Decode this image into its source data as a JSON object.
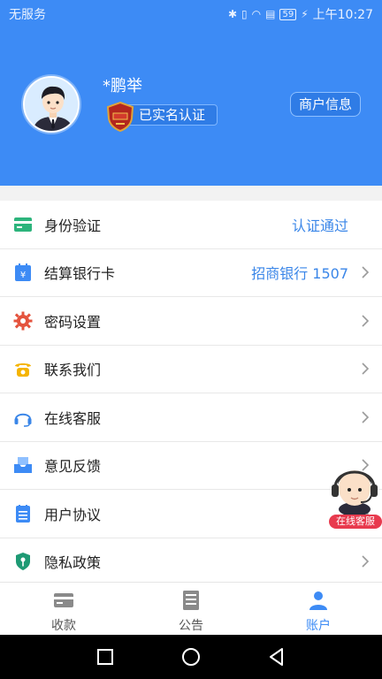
{
  "status_bar": {
    "carrier": "无服务",
    "battery": "59",
    "time": "上午10:27"
  },
  "profile": {
    "name": "*鹏举",
    "verified_label": "已实名认证",
    "merchant_button": "商户信息"
  },
  "menu": [
    {
      "label": "身份验证",
      "value": "认证通过",
      "icon": "id-card-icon",
      "color": "#2db47c",
      "arrow": false
    },
    {
      "label": "结算银行卡",
      "value": "招商银行 1507",
      "icon": "calendar-bank-icon",
      "color": "#3d8bf5",
      "arrow": true
    },
    {
      "label": "密码设置",
      "value": "",
      "icon": "gear-icon",
      "color": "#e4533d",
      "arrow": true
    },
    {
      "label": "联系我们",
      "value": "",
      "icon": "phone-icon",
      "color": "#f5b400",
      "arrow": true
    },
    {
      "label": "在线客服",
      "value": "",
      "icon": "headset-icon",
      "color": "#3a86e8",
      "arrow": true
    },
    {
      "label": "意见反馈",
      "value": "",
      "icon": "mail-tray-icon",
      "color": "#3d8bf5",
      "arrow": true
    },
    {
      "label": "用户协议",
      "value": "",
      "icon": "document-list-icon",
      "color": "#3d8bf5",
      "arrow": true
    },
    {
      "label": "隐私政策",
      "value": "",
      "icon": "shield-key-icon",
      "color": "#1e9a74",
      "arrow": true
    }
  ],
  "floating_service": {
    "label": "在线客服"
  },
  "tabs": [
    {
      "label": "收款",
      "icon": "card-icon",
      "active": false
    },
    {
      "label": "公告",
      "icon": "notice-icon",
      "active": false
    },
    {
      "label": "账户",
      "icon": "user-icon",
      "active": true
    }
  ],
  "colors": {
    "primary": "#3d8bf5",
    "link": "#3a86e8",
    "badge": "#e83a4e"
  }
}
